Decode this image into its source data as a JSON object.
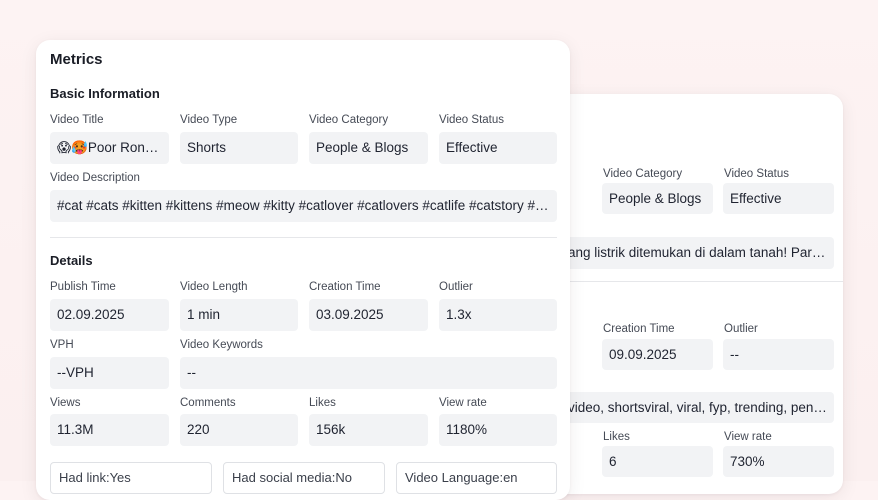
{
  "back_card": {
    "video_category_label": "Video Category",
    "video_category_value": "People & Blogs",
    "video_status_label": "Video Status",
    "video_status_value": "Effective",
    "description_value": "ang listrik ditemukan di dalam tanah! Para pe...",
    "creation_time_label": "Creation Time",
    "creation_time_value": "09.09.2025",
    "outlier_label": "Outlier",
    "outlier_value": "--",
    "keywords_value": "video, shortsviral, viral, fyp, trending, pencil, g...",
    "likes_label": "Likes",
    "likes_value": "6",
    "view_rate_label": "View rate",
    "view_rate_value": "730%"
  },
  "metrics": {
    "title": "Metrics",
    "basic_info": {
      "heading": "Basic Information",
      "video_title_label": "Video Title",
      "video_title_value": "😱🥵Poor Ronal...",
      "video_type_label": "Video Type",
      "video_type_value": "Shorts",
      "video_category_label": "Video Category",
      "video_category_value": "People & Blogs",
      "video_status_label": "Video Status",
      "video_status_value": "Effective",
      "video_description_label": "Video Description",
      "video_description_value": "#cat #cats #kitten #kittens #meow #kitty #catlover #catlovers #catlife #catstory #s..."
    },
    "details": {
      "heading": "Details",
      "publish_time_label": "Publish Time",
      "publish_time_value": "02.09.2025",
      "video_length_label": "Video Length",
      "video_length_value": "1 min",
      "creation_time_label": "Creation Time",
      "creation_time_value": "03.09.2025",
      "outlier_label": "Outlier",
      "outlier_value": "1.3x",
      "vph_label": "VPH",
      "vph_value": "--VPH",
      "video_keywords_label": "Video Keywords",
      "video_keywords_value": "--",
      "views_label": "Views",
      "views_value": "11.3M",
      "comments_label": "Comments",
      "comments_value": "220",
      "likes_label": "Likes",
      "likes_value": "156k",
      "view_rate_label": "View rate",
      "view_rate_value": "1180%",
      "had_link": "Had link:Yes",
      "had_social_media": "Had social media:No",
      "video_language": "Video Language:en"
    }
  }
}
